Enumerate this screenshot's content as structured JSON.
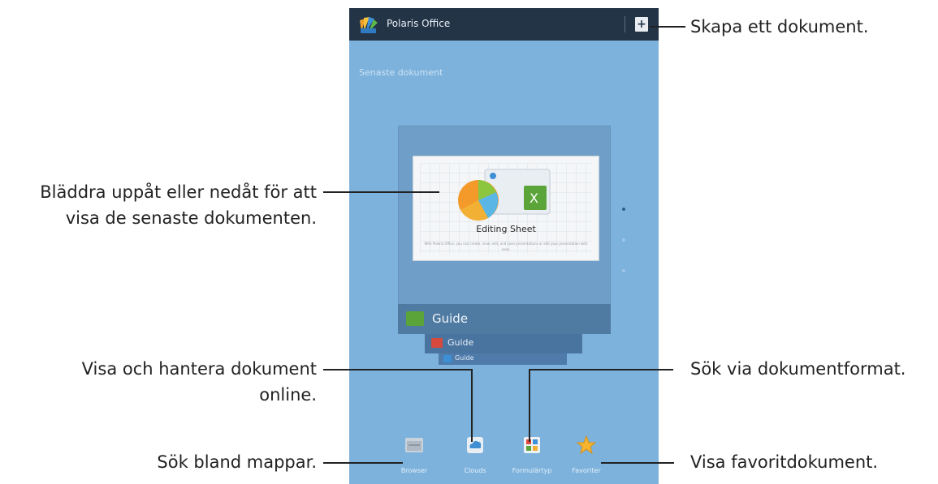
{
  "app": {
    "title": "Polaris Office"
  },
  "recent": {
    "label": "Senaste dokument",
    "preview_title": "Editing Sheet",
    "preview_desc": "With Polaris Office, you can create, view, edit, and save presentations or edit your presentation with ease.",
    "items": [
      {
        "label": "Guide",
        "type": "sheet"
      },
      {
        "label": "Guide",
        "type": "presentation"
      },
      {
        "label": "Guide",
        "type": "document"
      }
    ]
  },
  "toolbar": {
    "items": [
      {
        "label": "Browser",
        "icon": "folder-icon"
      },
      {
        "label": "Clouds",
        "icon": "cloud-icon"
      },
      {
        "label": "Formulärtyp",
        "icon": "form-type-icon"
      },
      {
        "label": "Favoriter",
        "icon": "star-icon"
      }
    ]
  },
  "callouts": {
    "create": "Skapa ett dokument.",
    "browse_line1": "Bläddra uppåt eller nedåt för att",
    "browse_line2": "visa de senaste dokumenten.",
    "online_line1": "Visa och hantera dokument",
    "online_line2": "online.",
    "folders": "Sök bland mappar.",
    "format": "Sök via dokumentformat.",
    "favorites": "Visa favoritdokument."
  },
  "colors": {
    "screen_bg": "#7db2dc",
    "top_bar": "#243447",
    "card": "#4f7aa2"
  }
}
